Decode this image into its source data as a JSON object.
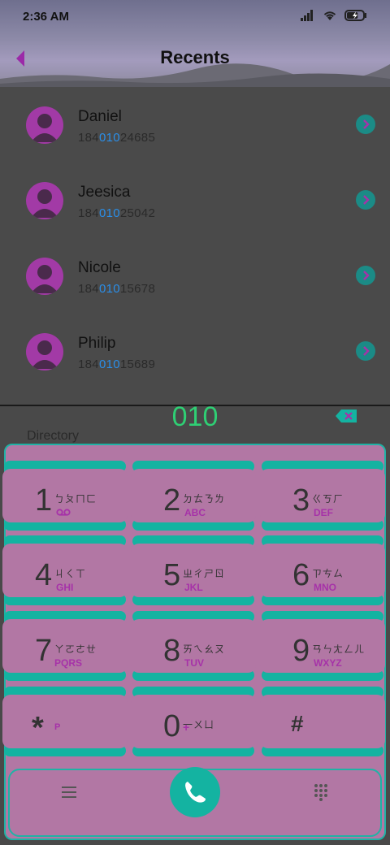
{
  "status_bar": {
    "time": "2:36 AM",
    "battery_level": 0.7
  },
  "header": {
    "title": "Recents"
  },
  "recents": [
    {
      "name": "Daniel",
      "number_prefix": "184",
      "number_match": "010",
      "number_suffix": "24685"
    },
    {
      "name": "Jeesica",
      "number_prefix": "184",
      "number_match": "010",
      "number_suffix": "25042"
    },
    {
      "name": "Nicole",
      "number_prefix": "184",
      "number_match": "010",
      "number_suffix": "15678"
    },
    {
      "name": "Philip",
      "number_prefix": "184",
      "number_match": "010",
      "number_suffix": "15689"
    }
  ],
  "dialer": {
    "typed_number": "010",
    "directory_label": "Directory",
    "keys": [
      {
        "digit": "1",
        "bopomofo": "ㄅㄆㄇㄈ",
        "letters": ""
      },
      {
        "digit": "2",
        "bopomofo": "ㄉㄊㄋㄌ",
        "letters": "ABC"
      },
      {
        "digit": "3",
        "bopomofo": "ㄍㄎㄏ",
        "letters": "DEF"
      },
      {
        "digit": "4",
        "bopomofo": "ㄐㄑㄒ",
        "letters": "GHI"
      },
      {
        "digit": "5",
        "bopomofo": "ㄓㄔㄕㄖ",
        "letters": "JKL"
      },
      {
        "digit": "6",
        "bopomofo": "ㄗㄘㄙ",
        "letters": "MNO"
      },
      {
        "digit": "7",
        "bopomofo": "ㄚㄛㄜㄝ",
        "letters": "PQRS"
      },
      {
        "digit": "8",
        "bopomofo": "ㄞㄟㄠㄡ",
        "letters": "TUV"
      },
      {
        "digit": "9",
        "bopomofo": "ㄢㄣㄤㄥㄦ",
        "letters": "WXYZ"
      },
      {
        "digit": "*",
        "bopomofo": "",
        "letters": "P"
      },
      {
        "digit": "0",
        "bopomofo": "一ㄨㄩ",
        "letters": "+"
      },
      {
        "digit": "#",
        "bopomofo": "",
        "letters": ""
      }
    ]
  },
  "icons": {
    "back": "back-arrow-icon",
    "call": "phone-icon",
    "menu": "menu-icon",
    "keypad": "dialpad-icon",
    "backspace": "backspace-icon",
    "voicemail": "voicemail-icon"
  },
  "colors": {
    "accent_teal": "#14b3a1",
    "key_face": "#b277a4",
    "highlight_blue": "#2a8ee8",
    "typed_green": "#2fcf74",
    "avatar_purple": "#a23aa6"
  }
}
